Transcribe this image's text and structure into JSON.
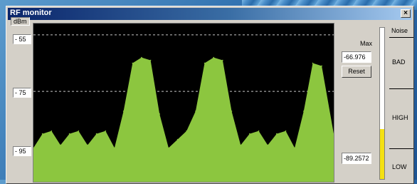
{
  "window": {
    "title": "RF monitor",
    "close_glyph": "×"
  },
  "axis": {
    "unit": "dBm",
    "ticks": [
      "- 55",
      "- 75",
      "- 95"
    ]
  },
  "max": {
    "label": "Max",
    "value": "-66.976",
    "reset_label": "Reset"
  },
  "current": {
    "value": "-89.2572"
  },
  "noise": {
    "title": "Noise",
    "levels": [
      "BAD",
      "HIGH",
      "LOW"
    ],
    "fill_fraction": 0.33
  },
  "colors": {
    "trace": "#8cc63f",
    "plot_bg": "#000000",
    "grid": "#c8c8c8",
    "meter": "#f4e012"
  },
  "chart_data": {
    "type": "area",
    "ylabel": "dBm",
    "ylim": [
      -107,
      -51
    ],
    "yticks": [
      -55,
      -75,
      -95
    ],
    "grid": true,
    "x": [
      0,
      3,
      6,
      9,
      12,
      15,
      18,
      21,
      24,
      27,
      30,
      33,
      36,
      39,
      42,
      45,
      48,
      51,
      54,
      57,
      60,
      63,
      66,
      69,
      72,
      75,
      78,
      81,
      84,
      87,
      90,
      93,
      96,
      100
    ],
    "y": [
      -95,
      -90,
      -89,
      -94,
      -90,
      -89,
      -94,
      -90,
      -89,
      -95,
      -82,
      -65,
      -63,
      -64,
      -83,
      -95,
      -92,
      -89,
      -82,
      -65,
      -63,
      -64,
      -82,
      -94,
      -90,
      -89,
      -94,
      -90,
      -89,
      -95,
      -82,
      -65,
      -66,
      -90
    ]
  }
}
